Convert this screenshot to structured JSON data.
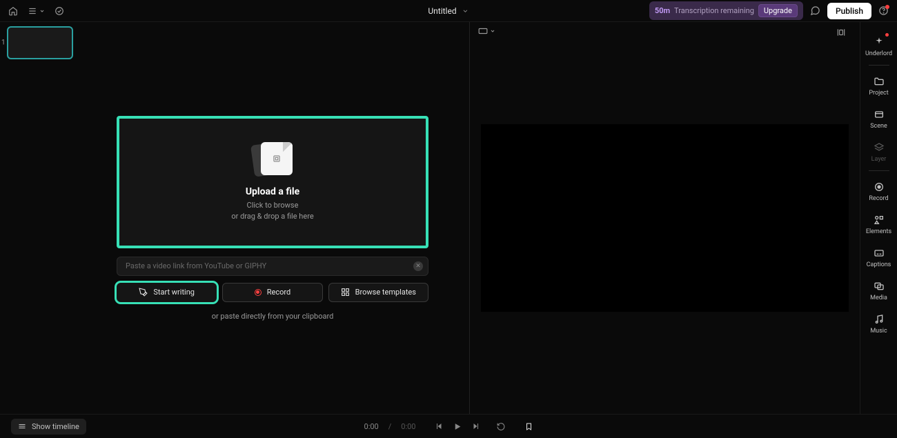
{
  "topbar": {
    "title": "Untitled",
    "transcription_minutes": "50m",
    "transcription_text": "Transcription remaining",
    "upgrade_label": "Upgrade",
    "publish_label": "Publish"
  },
  "scenes": {
    "items": [
      {
        "number": "1"
      }
    ]
  },
  "editor": {
    "upload_title": "Upload a file",
    "upload_line1": "Click to browse",
    "upload_line2": "or drag & drop a file here",
    "paste_placeholder": "Paste a video link from YouTube or GIPHY",
    "start_writing_label": "Start writing",
    "record_label": "Record",
    "browse_templates_label": "Browse templates",
    "clipboard_hint": "or paste directly from your clipboard"
  },
  "rightbar": {
    "items": [
      {
        "label": "Underlord",
        "icon": "sparkle"
      },
      {
        "label": "Project",
        "icon": "folder"
      },
      {
        "label": "Scene",
        "icon": "scene"
      },
      {
        "label": "Layer",
        "icon": "layers",
        "disabled": true
      },
      {
        "label": "Record",
        "icon": "record"
      },
      {
        "label": "Elements",
        "icon": "elements"
      },
      {
        "label": "Captions",
        "icon": "captions"
      },
      {
        "label": "Media",
        "icon": "media"
      },
      {
        "label": "Music",
        "icon": "music"
      }
    ]
  },
  "bottombar": {
    "show_timeline_label": "Show timeline",
    "current_time": "0:00",
    "total_time": "0:00"
  }
}
